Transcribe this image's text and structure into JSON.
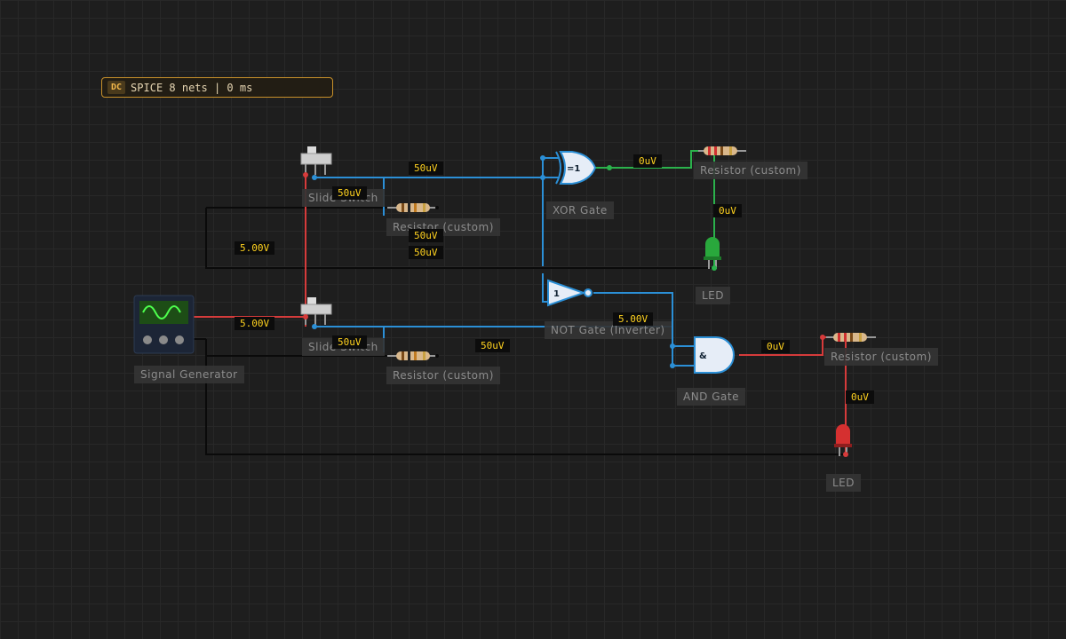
{
  "status": {
    "mode": "DC",
    "text": "SPICE 8 nets | 0 ms"
  },
  "components": {
    "slide_switch_1": "Slide Switch",
    "slide_switch_2": "Slide Switch",
    "resistor_1": "Resistor (custom)",
    "resistor_2": "Resistor (custom)",
    "resistor_3": "Resistor (custom)",
    "resistor_4": "Resistor (custom)",
    "xor_gate": "XOR Gate",
    "not_gate": "NOT Gate (Inverter)",
    "and_gate": "AND Gate",
    "led_1": "LED",
    "led_2": "LED",
    "signal_generator": "Signal Generator"
  },
  "gate_symbols": {
    "xor": "=1",
    "not": "1",
    "and": "&"
  },
  "probes": {
    "p1": "50uV",
    "p2": "50uV",
    "p3": "0uV",
    "p4": "0uV",
    "p5": "5.00V",
    "p6": "50uV",
    "p7": "50uV",
    "p8": "5.00V",
    "p9": "5.00V",
    "p10": "50uV",
    "p11": "50uV",
    "p12": "0uV",
    "p13": "0uV"
  },
  "colors": {
    "background": "#1e1e1e",
    "grid": "#282828",
    "wire_signal": "#2b8fd6",
    "wire_high": "#d63b3b",
    "wire_green": "#2bb24c",
    "wire_ground": "#0a0a0a",
    "probe_text": "#ffd21f",
    "status_border": "#c8902a"
  },
  "icons": {
    "slide_switch": "slide-switch-icon",
    "resistor": "resistor-icon",
    "led_green": "green-led-icon",
    "led_red": "red-led-icon",
    "signal_generator": "sine-wave-icon"
  }
}
